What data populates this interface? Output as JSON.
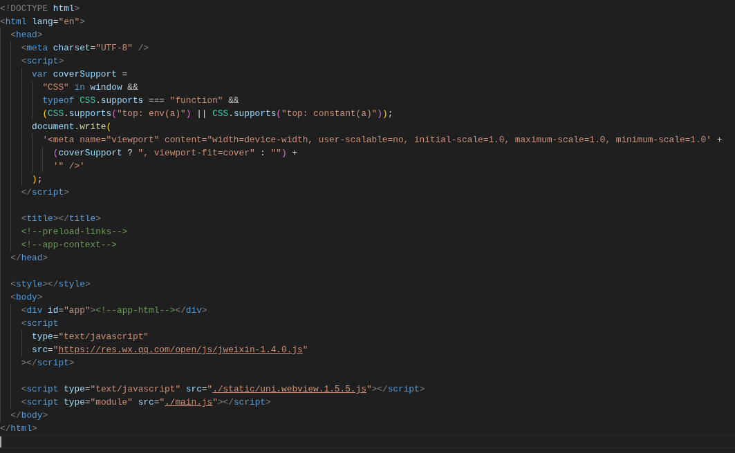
{
  "editor": {
    "lines": [
      {
        "blank_line_before": false,
        "tokens": [
          {
            "kind": "punct",
            "text": "<!DOCTYPE"
          },
          {
            "kind": "attr",
            "text": " html"
          },
          {
            "kind": "punct",
            "text": ">"
          }
        ]
      },
      {
        "blank_line_before": false,
        "tokens": [
          {
            "kind": "punct",
            "text": "<"
          },
          {
            "kind": "tag",
            "text": "html"
          },
          {
            "kind": "attr",
            "text": " lang"
          },
          {
            "kind": "operator",
            "text": "="
          },
          {
            "kind": "string",
            "text": "\"en\""
          },
          {
            "kind": "punct",
            "text": ">"
          }
        ]
      },
      {
        "blank_line_before": false,
        "tokens": [
          {
            "kind": "punct",
            "text": "  <"
          },
          {
            "kind": "tag",
            "text": "head"
          },
          {
            "kind": "punct",
            "text": ">"
          }
        ]
      },
      {
        "blank_line_before": false,
        "tokens": [
          {
            "kind": "punct",
            "text": "    <"
          },
          {
            "kind": "tag",
            "text": "meta"
          },
          {
            "kind": "attr",
            "text": " charset"
          },
          {
            "kind": "operator",
            "text": "="
          },
          {
            "kind": "string",
            "text": "\"UTF-8\""
          },
          {
            "kind": "punct",
            "text": " />"
          }
        ]
      },
      {
        "blank_line_before": false,
        "tokens": [
          {
            "kind": "punct",
            "text": "    <"
          },
          {
            "kind": "tag",
            "text": "script"
          },
          {
            "kind": "punct",
            "text": ">"
          }
        ]
      },
      {
        "blank_line_before": false,
        "tokens": [
          {
            "kind": "keyword",
            "text": "      var"
          },
          {
            "kind": "variable",
            "text": " coverSupport"
          },
          {
            "kind": "operator",
            "text": " ="
          }
        ]
      },
      {
        "blank_line_before": false,
        "tokens": [
          {
            "kind": "string",
            "text": "        \"CSS\""
          },
          {
            "kind": "keyword",
            "text": " in"
          },
          {
            "kind": "variable",
            "text": " window"
          },
          {
            "kind": "operator",
            "text": " &&"
          }
        ]
      },
      {
        "blank_line_before": false,
        "tokens": [
          {
            "kind": "keyword",
            "text": "        typeof"
          },
          {
            "kind": "type",
            "text": " CSS"
          },
          {
            "kind": "operator",
            "text": "."
          },
          {
            "kind": "variable",
            "text": "supports"
          },
          {
            "kind": "operator",
            "text": " === "
          },
          {
            "kind": "string",
            "text": "\"function\""
          },
          {
            "kind": "operator",
            "text": " &&"
          }
        ]
      },
      {
        "blank_line_before": false,
        "tokens": [
          {
            "kind": "bracket1",
            "text": "        ("
          },
          {
            "kind": "type",
            "text": "CSS"
          },
          {
            "kind": "operator",
            "text": "."
          },
          {
            "kind": "variable",
            "text": "supports"
          },
          {
            "kind": "bracket2",
            "text": "("
          },
          {
            "kind": "string",
            "text": "\"top: env(a)\""
          },
          {
            "kind": "bracket2",
            "text": ")"
          },
          {
            "kind": "operator",
            "text": " || "
          },
          {
            "kind": "type",
            "text": "CSS"
          },
          {
            "kind": "operator",
            "text": "."
          },
          {
            "kind": "variable",
            "text": "supports"
          },
          {
            "kind": "bracket2",
            "text": "("
          },
          {
            "kind": "string",
            "text": "\"top: constant(a)\""
          },
          {
            "kind": "bracket2",
            "text": ")"
          },
          {
            "kind": "bracket1",
            "text": ")"
          },
          {
            "kind": "operator",
            "text": ";"
          }
        ]
      },
      {
        "blank_line_before": false,
        "tokens": [
          {
            "kind": "variable",
            "text": "      document"
          },
          {
            "kind": "operator",
            "text": "."
          },
          {
            "kind": "function",
            "text": "write"
          },
          {
            "kind": "bracket1",
            "text": "("
          }
        ]
      },
      {
        "blank_line_before": false,
        "tokens": [
          {
            "kind": "string",
            "text": "        '<meta name=\"viewport\" content=\"width=device-width, user-scalable=no, initial-scale=1.0, maximum-scale=1.0, minimum-scale=1.0'"
          },
          {
            "kind": "operator",
            "text": " +"
          }
        ]
      },
      {
        "blank_line_before": false,
        "tokens": [
          {
            "kind": "bracket2",
            "text": "          ("
          },
          {
            "kind": "variable",
            "text": "coverSupport"
          },
          {
            "kind": "operator",
            "text": " ? "
          },
          {
            "kind": "string",
            "text": "\", viewport-fit=cover\""
          },
          {
            "kind": "operator",
            "text": " : "
          },
          {
            "kind": "string",
            "text": "\"\""
          },
          {
            "kind": "bracket2",
            "text": ")"
          },
          {
            "kind": "operator",
            "text": " +"
          }
        ]
      },
      {
        "blank_line_before": false,
        "tokens": [
          {
            "kind": "string",
            "text": "          '\" />'"
          }
        ]
      },
      {
        "blank_line_before": false,
        "tokens": [
          {
            "kind": "bracket1",
            "text": "      )"
          },
          {
            "kind": "operator",
            "text": ";"
          }
        ]
      },
      {
        "blank_line_before": false,
        "tokens": [
          {
            "kind": "punct",
            "text": "    </"
          },
          {
            "kind": "tag",
            "text": "script"
          },
          {
            "kind": "punct",
            "text": ">"
          }
        ]
      },
      {
        "blank_line_before": true,
        "tokens": [
          {
            "kind": "punct",
            "text": "    <"
          },
          {
            "kind": "tag",
            "text": "title"
          },
          {
            "kind": "punct",
            "text": "></"
          },
          {
            "kind": "tag",
            "text": "title"
          },
          {
            "kind": "punct",
            "text": ">"
          }
        ]
      },
      {
        "blank_line_before": false,
        "tokens": [
          {
            "kind": "comment",
            "text": "    <!--preload-links-->"
          }
        ]
      },
      {
        "blank_line_before": false,
        "tokens": [
          {
            "kind": "comment",
            "text": "    <!--app-context-->"
          }
        ]
      },
      {
        "blank_line_before": false,
        "tokens": [
          {
            "kind": "punct",
            "text": "  </"
          },
          {
            "kind": "tag",
            "text": "head"
          },
          {
            "kind": "punct",
            "text": ">"
          }
        ]
      },
      {
        "blank_line_before": true,
        "tokens": [
          {
            "kind": "punct",
            "text": "  <"
          },
          {
            "kind": "tag",
            "text": "style"
          },
          {
            "kind": "punct",
            "text": "></"
          },
          {
            "kind": "tag",
            "text": "style"
          },
          {
            "kind": "punct",
            "text": ">"
          }
        ]
      },
      {
        "blank_line_before": false,
        "tokens": [
          {
            "kind": "punct",
            "text": "  <"
          },
          {
            "kind": "tag",
            "text": "body"
          },
          {
            "kind": "punct",
            "text": ">"
          }
        ]
      },
      {
        "blank_line_before": false,
        "tokens": [
          {
            "kind": "punct",
            "text": "    <"
          },
          {
            "kind": "tag",
            "text": "div"
          },
          {
            "kind": "attr",
            "text": " id"
          },
          {
            "kind": "operator",
            "text": "="
          },
          {
            "kind": "string",
            "text": "\"app\""
          },
          {
            "kind": "punct",
            "text": ">"
          },
          {
            "kind": "comment",
            "text": "<!--app-html-->"
          },
          {
            "kind": "punct",
            "text": "</"
          },
          {
            "kind": "tag",
            "text": "div"
          },
          {
            "kind": "punct",
            "text": ">"
          }
        ]
      },
      {
        "blank_line_before": false,
        "tokens": [
          {
            "kind": "punct",
            "text": "    <"
          },
          {
            "kind": "tag",
            "text": "script"
          }
        ]
      },
      {
        "blank_line_before": false,
        "tokens": [
          {
            "kind": "attr",
            "text": "      type"
          },
          {
            "kind": "operator",
            "text": "="
          },
          {
            "kind": "string",
            "text": "\"text/javascript\""
          }
        ]
      },
      {
        "blank_line_before": false,
        "tokens": [
          {
            "kind": "attr",
            "text": "      src"
          },
          {
            "kind": "operator",
            "text": "="
          },
          {
            "kind": "string",
            "text": "\""
          },
          {
            "kind": "link",
            "text": "https://res.wx.qq.com/open/js/jweixin-1.4.0.js"
          },
          {
            "kind": "string",
            "text": "\""
          }
        ]
      },
      {
        "blank_line_before": false,
        "tokens": [
          {
            "kind": "punct",
            "text": "    ></"
          },
          {
            "kind": "tag",
            "text": "script"
          },
          {
            "kind": "punct",
            "text": ">"
          }
        ]
      },
      {
        "blank_line_before": true,
        "tokens": [
          {
            "kind": "punct",
            "text": "    <"
          },
          {
            "kind": "tag",
            "text": "script"
          },
          {
            "kind": "attr",
            "text": " type"
          },
          {
            "kind": "operator",
            "text": "="
          },
          {
            "kind": "string",
            "text": "\"text/javascript\""
          },
          {
            "kind": "attr",
            "text": " src"
          },
          {
            "kind": "operator",
            "text": "="
          },
          {
            "kind": "string",
            "text": "\""
          },
          {
            "kind": "link",
            "text": "./static/uni.webview.1.5.5.js"
          },
          {
            "kind": "string",
            "text": "\""
          },
          {
            "kind": "punct",
            "text": "></"
          },
          {
            "kind": "tag",
            "text": "script"
          },
          {
            "kind": "punct",
            "text": ">"
          }
        ]
      },
      {
        "blank_line_before": false,
        "tokens": [
          {
            "kind": "punct",
            "text": "    <"
          },
          {
            "kind": "tag",
            "text": "script"
          },
          {
            "kind": "attr",
            "text": " type"
          },
          {
            "kind": "operator",
            "text": "="
          },
          {
            "kind": "string",
            "text": "\"module\""
          },
          {
            "kind": "attr",
            "text": " src"
          },
          {
            "kind": "operator",
            "text": "="
          },
          {
            "kind": "string",
            "text": "\""
          },
          {
            "kind": "link",
            "text": "./main.js"
          },
          {
            "kind": "string",
            "text": "\""
          },
          {
            "kind": "punct",
            "text": "></"
          },
          {
            "kind": "tag",
            "text": "script"
          },
          {
            "kind": "punct",
            "text": ">"
          }
        ]
      },
      {
        "blank_line_before": false,
        "tokens": [
          {
            "kind": "punct",
            "text": "  </"
          },
          {
            "kind": "tag",
            "text": "body"
          },
          {
            "kind": "punct",
            "text": ">"
          }
        ]
      },
      {
        "blank_line_before": false,
        "tokens": [
          {
            "kind": "punct",
            "text": "</"
          },
          {
            "kind": "tag",
            "text": "html"
          },
          {
            "kind": "punct",
            "text": ">"
          }
        ]
      }
    ]
  }
}
